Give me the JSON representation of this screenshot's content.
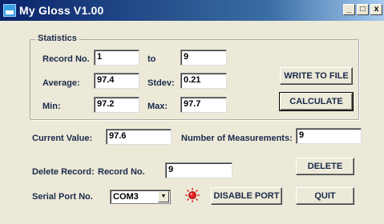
{
  "window": {
    "title": "My Gloss  V1.00",
    "controls": {
      "minimize": "_",
      "maximize": "□",
      "close": "x"
    }
  },
  "statistics": {
    "group_title": "Statistics",
    "record_no_label": "Record No.",
    "record_from": "1",
    "to_label": "to",
    "record_to": "9",
    "average_label": "Average:",
    "average": "97.4",
    "stdev_label": "Stdev:",
    "stdev": "0.21",
    "min_label": "Min:",
    "min": "97.2",
    "max_label": "Max:",
    "max": "97.7"
  },
  "buttons": {
    "write_to_file": "WRITE TO FILE",
    "calculate": "CALCULATE",
    "delete": "DELETE",
    "disable_port": "DISABLE PORT",
    "quit": "QUIT"
  },
  "current": {
    "label": "Current Value:",
    "value": "97.6",
    "count_label": "Number of Measurements:",
    "count": "9"
  },
  "delete_record": {
    "label": "Delete Record:",
    "record_no_label": "Record No.",
    "value": "9"
  },
  "serial": {
    "label": "Serial Port No.",
    "selected": "COM3"
  },
  "icons": {
    "port_status": "red-indicator-icon",
    "app": "app-icon"
  },
  "colors": {
    "title_bar": "#0a246a",
    "indicator": "#e02020"
  }
}
